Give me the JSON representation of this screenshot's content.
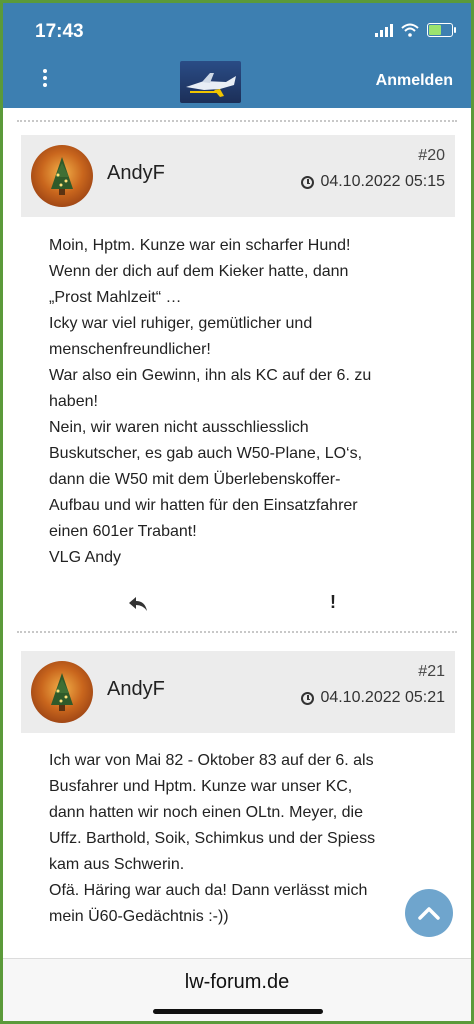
{
  "status_bar": {
    "time": "17:43"
  },
  "header": {
    "login_label": "Anmelden"
  },
  "posts": [
    {
      "author": "AndyF",
      "number": "#20",
      "date": "04.10.2022 05:15",
      "lines": [
        "Moin, Hptm. Kunze war ein scharfer Hund!",
        "Wenn der dich auf dem Kieker hatte, dann",
        "„Prost Mahlzeit“ …",
        "Icky war viel ruhiger, gemütlicher und",
        "menschenfreundlicher!",
        "War also ein Gewinn, ihn als KC auf der 6. zu",
        "haben!",
        "Nein, wir waren nicht ausschliesslich",
        "Buskutscher, es gab auch W50-Plane, LO‘s,",
        "dann die W50 mit dem Überlebenskoffer-",
        "Aufbau und wir hatten für den Einsatzfahrer",
        "einen 601er Trabant!",
        "VLG Andy"
      ]
    },
    {
      "author": "AndyF",
      "number": "#21",
      "date": "04.10.2022 05:21",
      "lines": [
        "Ich war von Mai 82 - Oktober 83 auf der 6. als",
        "Busfahrer und Hptm. Kunze war unser KC,",
        "dann hatten wir noch einen OLtn. Meyer, die",
        "Uffz. Barthold, Soik, Schimkus und der Spiess",
        "kam aus Schwerin.",
        "Ofä. Häring war auch da! Dann verlässt mich",
        "mein Ü60-Gedächtnis :-))"
      ]
    }
  ],
  "actions": {
    "report_label": "!"
  },
  "footer": {
    "domain": "lw-forum.de"
  },
  "colors": {
    "header": "#3d7fb1",
    "scroll_button": "#6fa5cd"
  }
}
